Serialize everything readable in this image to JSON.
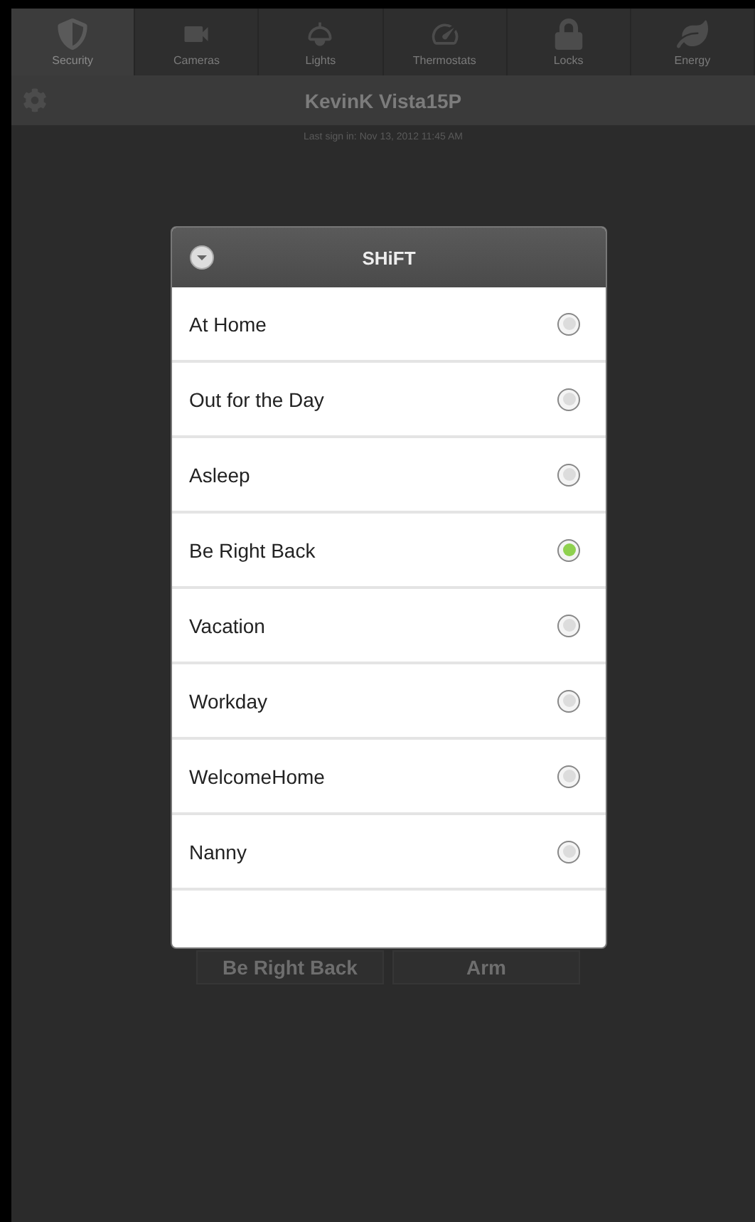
{
  "tabs": [
    {
      "label": "Security",
      "selected": true
    },
    {
      "label": "Cameras",
      "selected": false
    },
    {
      "label": "Lights",
      "selected": false
    },
    {
      "label": "Thermostats",
      "selected": false
    },
    {
      "label": "Locks",
      "selected": false
    },
    {
      "label": "Energy",
      "selected": false
    }
  ],
  "header": {
    "title": "KevinK Vista15P",
    "last_sign_in": "Last sign in: Nov 13, 2012 11:45 AM"
  },
  "background_buttons": [
    "Be Right Back",
    "Arm"
  ],
  "dialog": {
    "title": "SHiFT",
    "options": [
      {
        "label": "At Home",
        "selected": false
      },
      {
        "label": "Out for the Day",
        "selected": false
      },
      {
        "label": "Asleep",
        "selected": false
      },
      {
        "label": "Be Right Back",
        "selected": true
      },
      {
        "label": "Vacation",
        "selected": false
      },
      {
        "label": "Workday",
        "selected": false
      },
      {
        "label": "WelcomeHome",
        "selected": false
      },
      {
        "label": "Nanny",
        "selected": false
      }
    ]
  }
}
